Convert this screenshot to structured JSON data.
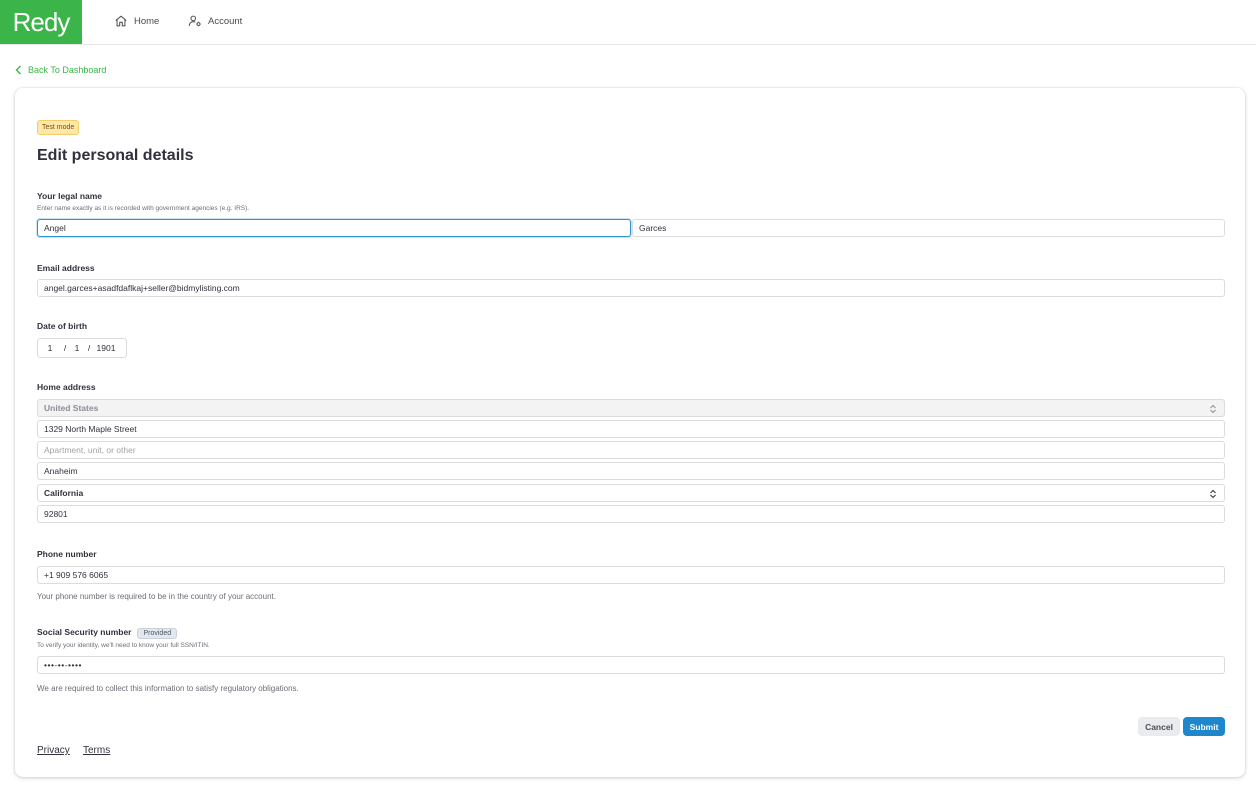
{
  "brand": {
    "logo_text": "Redy",
    "color": "#3bb54a"
  },
  "nav": {
    "home": {
      "label": "Home",
      "icon": "home-icon"
    },
    "account": {
      "label": "Account",
      "icon": "user-settings-icon"
    }
  },
  "back_link": "Back To Dashboard",
  "card": {
    "badge": "Test mode",
    "title": "Edit personal details",
    "legal_name": {
      "label": "Your legal name",
      "hint": "Enter name exactly as it is recorded with government agencies (e.g. IRS).",
      "first_name": "Angel",
      "last_name": "Garces"
    },
    "email": {
      "label": "Email address",
      "value": "angel.garces+asadfdaflkaj+seller@bidmylisting.com"
    },
    "dob": {
      "label": "Date of birth",
      "month": "1",
      "day": "1",
      "year": "1901",
      "separator": "/"
    },
    "address": {
      "label": "Home address",
      "country": "United States",
      "line1": "1329 North Maple Street",
      "line2_placeholder": "Apartment, unit, or other",
      "city": "Anaheim",
      "state": "California",
      "zip": "92801"
    },
    "phone": {
      "label": "Phone number",
      "value": "+1  909 576 6065",
      "help": "Your phone number is required to be in the country of your account."
    },
    "ssn": {
      "label": "Social Security number",
      "badge": "Provided",
      "hint": "To verify your identity, we'll need to know your full SSN/ITIN.",
      "value": "•••-••-••••",
      "help": "We are required to collect this information to satisfy regulatory obligations."
    },
    "buttons": {
      "cancel": "Cancel",
      "submit": "Submit"
    },
    "footer": {
      "privacy": "Privacy",
      "terms": "Terms"
    }
  }
}
